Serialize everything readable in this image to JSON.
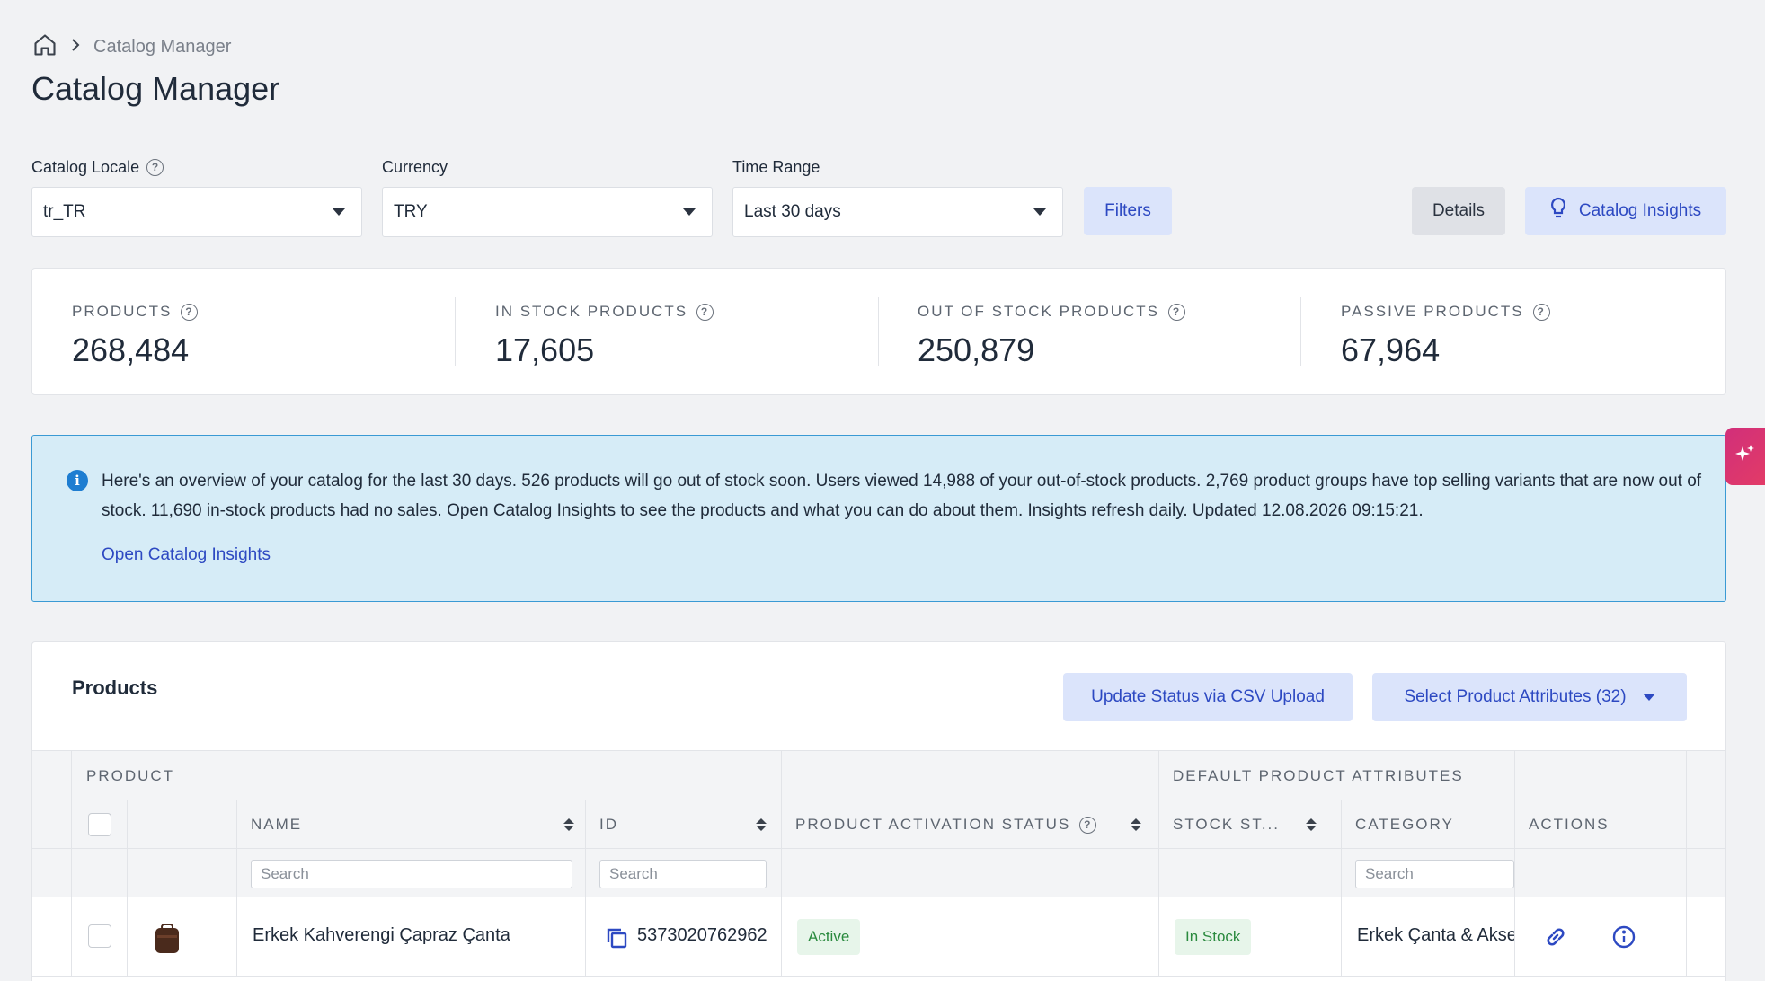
{
  "breadcrumb": {
    "current": "Catalog Manager"
  },
  "page_title": "Catalog Manager",
  "filters": {
    "locale": {
      "label": "Catalog Locale",
      "value": "tr_TR"
    },
    "currency": {
      "label": "Currency",
      "value": "TRY"
    },
    "time_range": {
      "label": "Time Range",
      "value": "Last 30 days"
    },
    "filters_button": "Filters",
    "details_button": "Details",
    "insights_button": "Catalog Insights"
  },
  "stats": [
    {
      "label": "PRODUCTS",
      "value": "268,484"
    },
    {
      "label": "IN STOCK PRODUCTS",
      "value": "17,605"
    },
    {
      "label": "OUT OF STOCK PRODUCTS",
      "value": "250,879"
    },
    {
      "label": "PASSIVE PRODUCTS",
      "value": "67,964"
    }
  ],
  "info": {
    "text": "Here's an overview of your catalog for the last 30 days. 526 products will go out of stock soon. Users viewed 14,988 of your out-of-stock products. 2,769 product groups have top selling variants that are now out of stock. 11,690 in-stock products had no sales. Open Catalog Insights to see the products and what you can do about them. Insights refresh daily. Updated 12.08.2026 09:15:21.",
    "link": "Open Catalog Insights"
  },
  "products": {
    "title": "Products",
    "csv_button": "Update Status via CSV Upload",
    "attributes_button": "Select Product Attributes (32)",
    "groups": {
      "product": "PRODUCT",
      "default_attrs": "DEFAULT PRODUCT ATTRIBUTES"
    },
    "columns": {
      "name": "NAME",
      "id": "ID",
      "activation": "PRODUCT ACTIVATION STATUS",
      "stock": "STOCK ST...",
      "category": "CATEGORY",
      "actions": "ACTIONS"
    },
    "search_placeholder": "Search",
    "rows": [
      {
        "name": "Erkek Kahverengi Çapraz Çanta",
        "id": "5373020762962",
        "activation": "Active",
        "stock": "In Stock",
        "category": "Erkek Çanta & Aksesuar"
      }
    ]
  },
  "colors": {
    "accent": "#2d49c2",
    "button_blue_bg": "#dbe4fb",
    "info_bg": "#d6ecf7",
    "info_border": "#3a9ad4",
    "success": "#2a8a3e",
    "fab": "#e23b67"
  }
}
